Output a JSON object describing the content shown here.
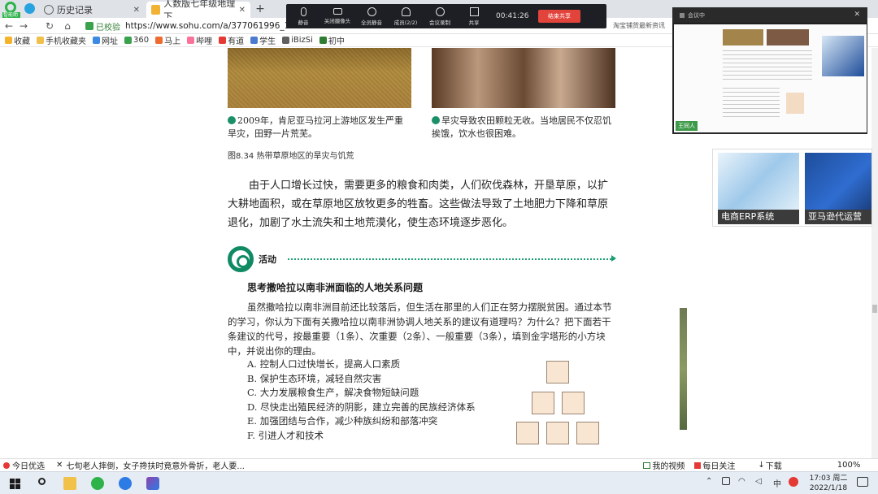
{
  "browser": {
    "app_badge": "智能助手",
    "tabs": [
      {
        "label": "历史记录"
      },
      {
        "label": "人数版七年级地理下",
        "active": true
      }
    ],
    "secure_label": "已校验",
    "url": "https://www.sohu.com/a/377061996_12015",
    "ext_info": "淘宝铺货最新资讯"
  },
  "bookmarks": [
    "收藏",
    "手机收藏夹",
    "网址",
    "360",
    "马上",
    "哔哩",
    "有道",
    "学生",
    "iBizSi",
    "初中"
  ],
  "meeting": {
    "buttons": [
      "静音",
      "关闭摄像头",
      "全员静音",
      "成员(2/2)",
      "会议录制",
      "共享"
    ],
    "timer": "00:41:26",
    "end_button": "结束共享"
  },
  "video_panel": {
    "title": "会议中",
    "name_label": "王同人"
  },
  "ads": [
    {
      "label": "电商ERP系统"
    },
    {
      "label": "亚马逊代运营"
    }
  ],
  "document": {
    "caption_left": "2009年，肯尼亚马拉河上游地区发生严重旱灾，田野一片荒芜。",
    "caption_right": "旱灾导致农田颗粒无收。当地居民不仅忍饥挨饿，饮水也很困难。",
    "figure_title": "图8.34  热带草原地区的旱灾与饥荒",
    "paragraph": "由于人口增长过快，需要更多的粮食和肉类，人们砍伐森林，开垦草原，以扩大耕地面积，或在草原地区放牧更多的牲畜。这些做法导致了土地肥力下降和草原退化，加剧了水土流失和土地荒漠化，使生态环境逐步恶化。",
    "activity_label": "活动",
    "question_title": "思考撒哈拉以南非洲面临的人地关系问题",
    "question_text": "虽然撒哈拉以南非洲目前还比较落后，但生活在那里的人们正在努力摆脱贫困。通过本节的学习，你认为下面有关撒哈拉以南非洲协调人地关系的建议有道理吗？为什么？把下面若干条建议的代号，按最重要（1条）、次重要（2条）、一般重要（3条），填到金字塔形的小方块中，并说出你的理由。",
    "options": [
      "A. 控制人口过快增长，提高人口素质",
      "B. 保护生态环境，减轻自然灾害",
      "C. 大力发展粮食生产，解决食物短缺问题",
      "D. 尽快走出殖民经济的阴影，建立完善的民族经济体系",
      "E. 加强团结与合作，减少种族纠纷和部落冲突",
      "F. 引进人才和技术"
    ]
  },
  "news_bar": {
    "left_label": "今日优选",
    "headline": "七旬老人摔倒，女子搀扶时竟意外骨折，老人要...",
    "right_items": [
      "我的视频",
      "每日关注",
      "下载"
    ],
    "zoom": "100%"
  },
  "taskbar": {
    "ime": "中",
    "time": "17:03 周二",
    "date": "2022/1/18"
  },
  "colors": {
    "accent_green": "#0f8a62",
    "meeting_end": "#e2433b"
  }
}
